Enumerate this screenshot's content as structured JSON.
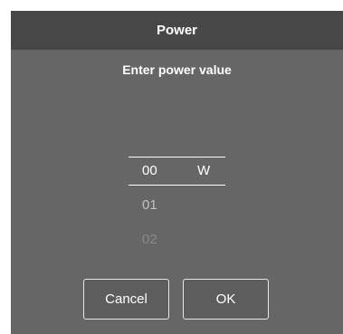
{
  "dialog": {
    "title": "Power",
    "prompt": "Enter power value"
  },
  "picker": {
    "selected_value": "00",
    "unit": "W",
    "next_values": [
      "01",
      "02"
    ]
  },
  "buttons": {
    "cancel_label": "Cancel",
    "ok_label": "OK"
  }
}
